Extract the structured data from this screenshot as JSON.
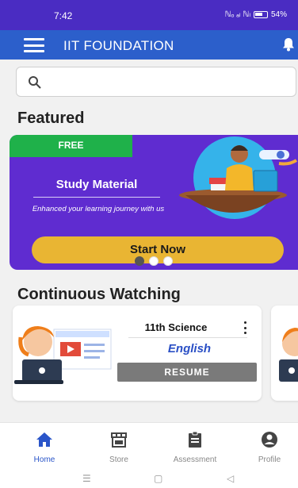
{
  "status_bar": {
    "time": "7:42",
    "signal": "ℕₒ ₐₗ ℕₗ",
    "battery": "54%"
  },
  "app_bar": {
    "title": "IIT FOUNDATION"
  },
  "search": {
    "placeholder": ""
  },
  "featured": {
    "title": "Featured",
    "tag": "FREE",
    "heading": "Study Material",
    "subtitle": "Enhanced your learning journey with us",
    "button": "Start Now",
    "slide_count": 3,
    "active_slide": 1
  },
  "continuous_watching": {
    "title": "Continuous Watching",
    "cards": [
      {
        "course": "11th Science",
        "language": "English",
        "action": "RESUME"
      }
    ]
  },
  "bottom_nav": {
    "items": [
      {
        "label": "Home",
        "icon": "home-icon",
        "active": true
      },
      {
        "label": "Store",
        "icon": "store-icon",
        "active": false
      },
      {
        "label": "Assessment",
        "icon": "assessment-icon",
        "active": false
      },
      {
        "label": "Profile",
        "icon": "profile-icon",
        "active": false
      }
    ]
  },
  "colors": {
    "status_bar": "#4a2cc2",
    "app_bar": "#2c5fcb",
    "banner": "#5f2cd0",
    "free_tag": "#1fb14a",
    "start_button": "#e9b533",
    "resume_button": "#7a7a7a",
    "active_nav": "#2a55c9"
  }
}
